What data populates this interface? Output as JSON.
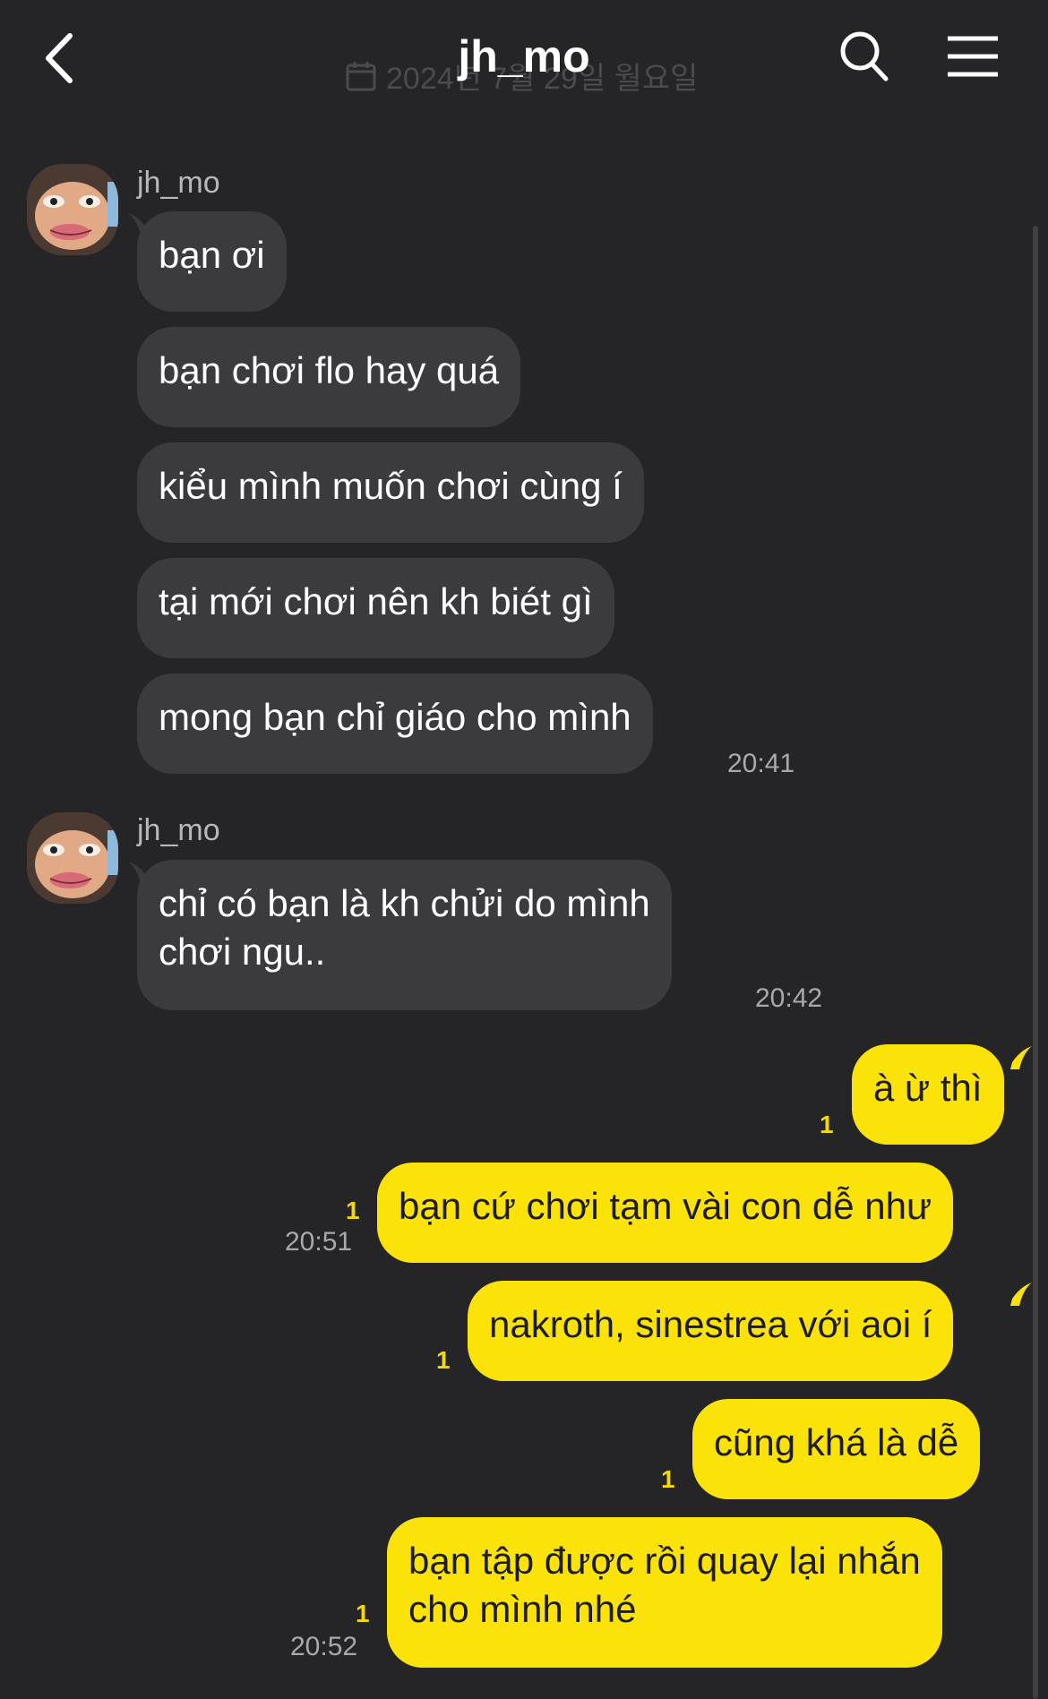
{
  "header": {
    "title": "jh_mo",
    "date_ghost": "2024년 7월 29일 월요일"
  },
  "colors": {
    "background": "#252528",
    "incoming_bubble": "#3b3b3f",
    "outgoing_bubble": "#fbe30a",
    "unread": "#f5d80a"
  },
  "groups": [
    {
      "sender": "jh_mo",
      "messages": [
        "bạn ơi",
        "bạn chơi flo hay quá",
        "kiểu mình muốn chơi cùng í",
        "tại mới chơi nên kh biét gì",
        "mong bạn chỉ giáo cho mình"
      ],
      "time": "20:41"
    },
    {
      "sender": "jh_mo",
      "messages": [
        "chỉ có bạn là kh chửi do mình\nchơi ngu.."
      ],
      "time": "20:42"
    }
  ],
  "outgoing": [
    {
      "text": "à ừ thì",
      "unread": "1"
    },
    {
      "text": "bạn cứ chơi tạm vài con dễ như",
      "unread": "1",
      "time": "20:51"
    },
    {
      "text": "nakroth, sinestrea với aoi í",
      "unread": "1"
    },
    {
      "text": "cũng khá là dễ",
      "unread": "1"
    },
    {
      "text": "bạn tập được rồi quay lại nhắn\ncho mình nhé",
      "unread": "1",
      "time": "20:52"
    }
  ]
}
